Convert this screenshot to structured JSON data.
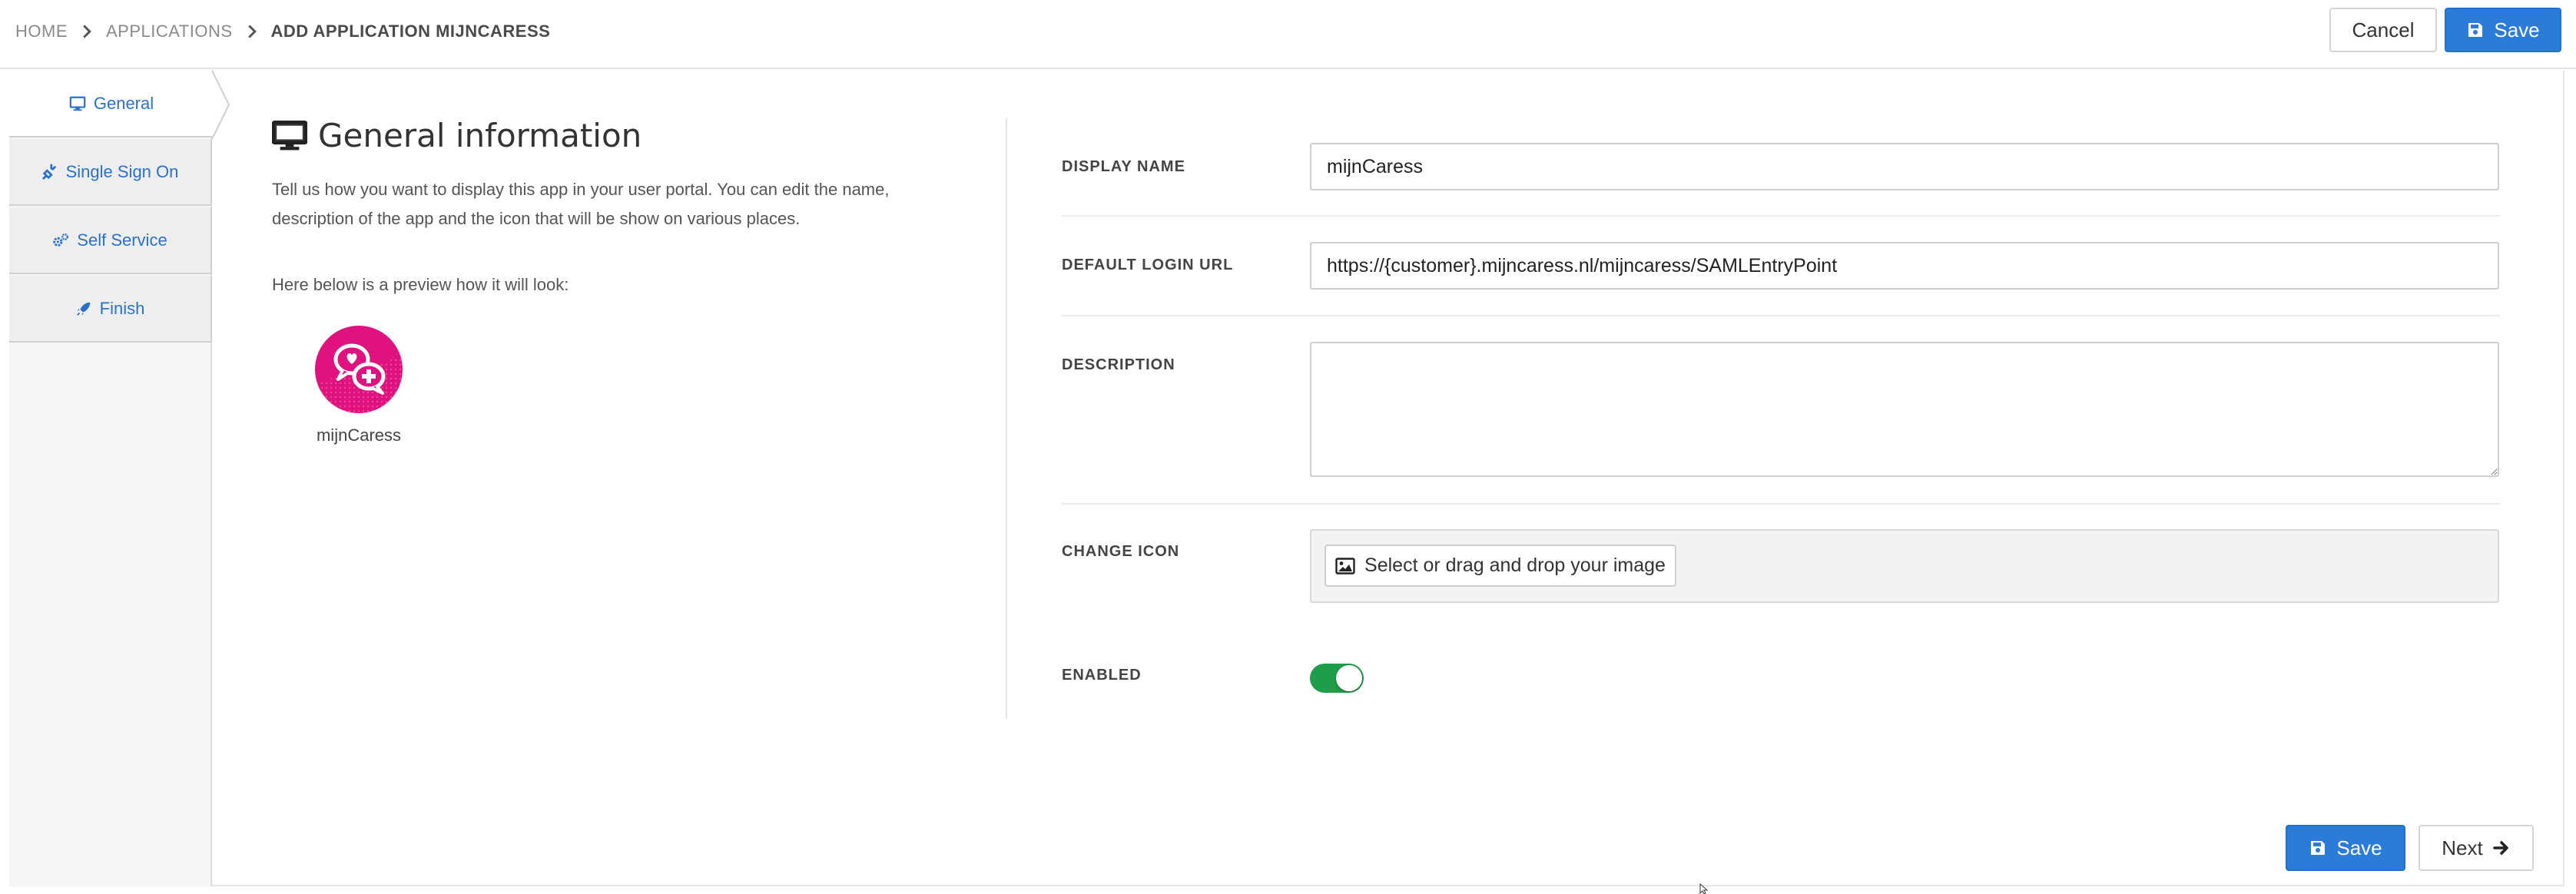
{
  "breadcrumb": {
    "items": [
      "HOME",
      "APPLICATIONS",
      "ADD APPLICATION MIJNCARESS"
    ]
  },
  "header": {
    "cancel_label": "Cancel",
    "save_label": "Save"
  },
  "tabs": [
    {
      "label": "General",
      "icon": "desktop-icon",
      "active": true
    },
    {
      "label": "Single Sign On",
      "icon": "plug-icon",
      "active": false
    },
    {
      "label": "Self Service",
      "icon": "gears-icon",
      "active": false
    },
    {
      "label": "Finish",
      "icon": "rocket-icon",
      "active": false
    }
  ],
  "info": {
    "title": "General information",
    "description": "Tell us how you want to display this app in your user portal. You can edit the name, description of the app and the icon that will be show on various places.",
    "preview_label": "Here below is a preview how it will look:",
    "app_name": "mijnCaress"
  },
  "form": {
    "display_name_label": "DISPLAY NAME",
    "display_name_value": "mijnCaress",
    "login_url_label": "DEFAULT LOGIN URL",
    "login_url_value": "https://{customer}.mijncaress.nl/mijncaress/SAMLEntryPoint",
    "description_label": "DESCRIPTION",
    "description_value": "",
    "change_icon_label": "CHANGE ICON",
    "select_image_label": "Select or drag and drop your image",
    "enabled_label": "ENABLED",
    "enabled": true
  },
  "footer": {
    "save_label": "Save",
    "next_label": "Next"
  },
  "colors": {
    "primary": "#2b7bd9",
    "link": "#2a72c9",
    "toggle_on": "#1e9e4a",
    "app_icon": "#e0127f"
  }
}
